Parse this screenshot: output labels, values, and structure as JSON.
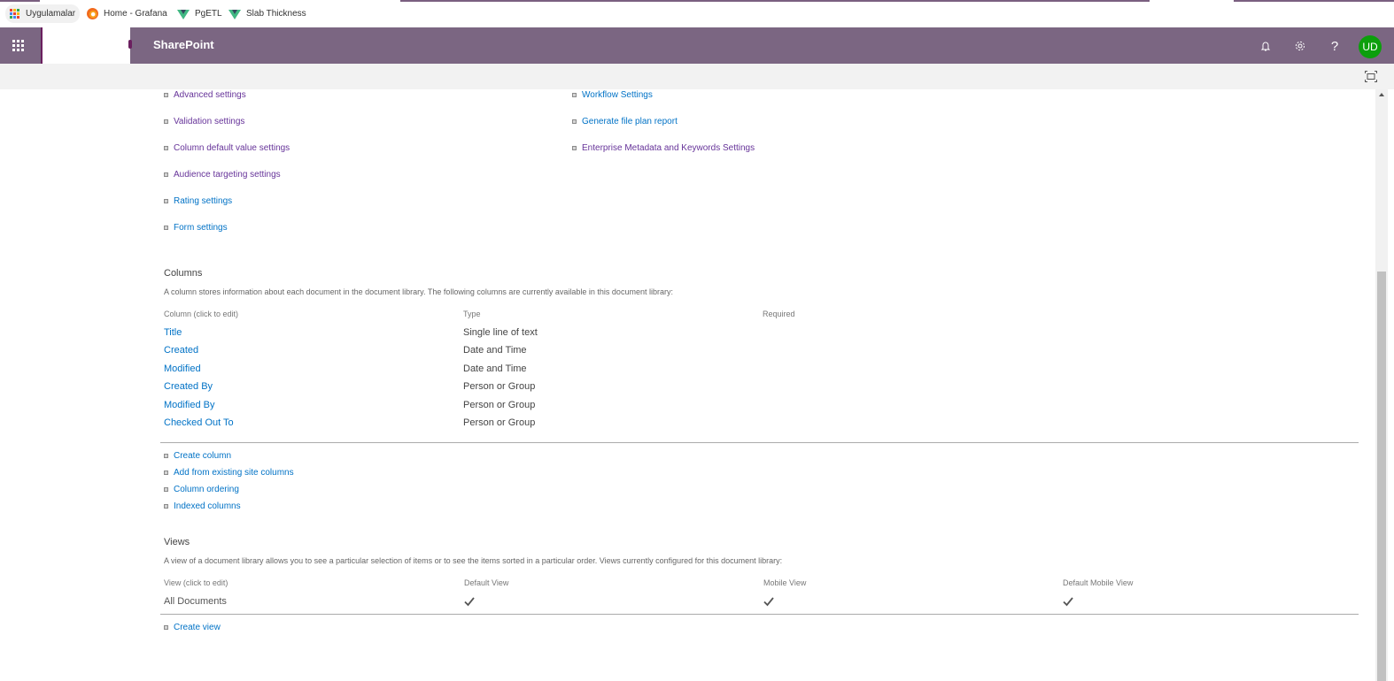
{
  "bookmarks": [
    {
      "label": "Uygulamalar",
      "icon": "apps-grid-icon"
    },
    {
      "label": "Home - Grafana",
      "icon": "grafana-icon"
    },
    {
      "label": "PgETL",
      "icon": "vue-icon"
    },
    {
      "label": "Slab Thickness",
      "icon": "vue-icon"
    }
  ],
  "suitebar": {
    "title": "SharePoint",
    "avatar_initials": "UD",
    "avatar_color": "#0c9f0c",
    "brand_color": "#7b6682",
    "help_label": "?"
  },
  "settings_links": {
    "left": [
      {
        "label": "Advanced settings",
        "visited": true
      },
      {
        "label": "Validation settings",
        "visited": true
      },
      {
        "label": "Column default value settings",
        "visited": true
      },
      {
        "label": "Audience targeting settings",
        "visited": true
      },
      {
        "label": "Rating settings",
        "visited": false
      },
      {
        "label": "Form settings",
        "visited": false
      }
    ],
    "right": [
      {
        "label": "Workflow Settings",
        "visited": false
      },
      {
        "label": "Generate file plan report",
        "visited": false
      },
      {
        "label": "Enterprise Metadata and Keywords Settings",
        "visited": true
      }
    ]
  },
  "columns": {
    "title": "Columns",
    "description": "A column stores information about each document in the document library. The following columns are currently available in this document library:",
    "headers": [
      "Column (click to edit)",
      "Type",
      "Required"
    ],
    "rows": [
      {
        "name": "Title",
        "type": "Single line of text",
        "required": ""
      },
      {
        "name": "Created",
        "type": "Date and Time",
        "required": ""
      },
      {
        "name": "Modified",
        "type": "Date and Time",
        "required": ""
      },
      {
        "name": "Created By",
        "type": "Person or Group",
        "required": ""
      },
      {
        "name": "Modified By",
        "type": "Person or Group",
        "required": ""
      },
      {
        "name": "Checked Out To",
        "type": "Person or Group",
        "required": ""
      }
    ],
    "actions": [
      "Create column",
      "Add from existing site columns",
      "Column ordering",
      "Indexed columns"
    ]
  },
  "views": {
    "title": "Views",
    "description": "A view of a document library allows you to see a particular selection of items or to see the items sorted in a particular order. Views currently configured for this document library:",
    "headers": [
      "View (click to edit)",
      "Default View",
      "Mobile View",
      "Default Mobile View"
    ],
    "rows": [
      {
        "name": "All Documents",
        "default_view": true,
        "mobile_view": true,
        "default_mobile_view": true
      }
    ],
    "actions": [
      "Create view"
    ]
  }
}
